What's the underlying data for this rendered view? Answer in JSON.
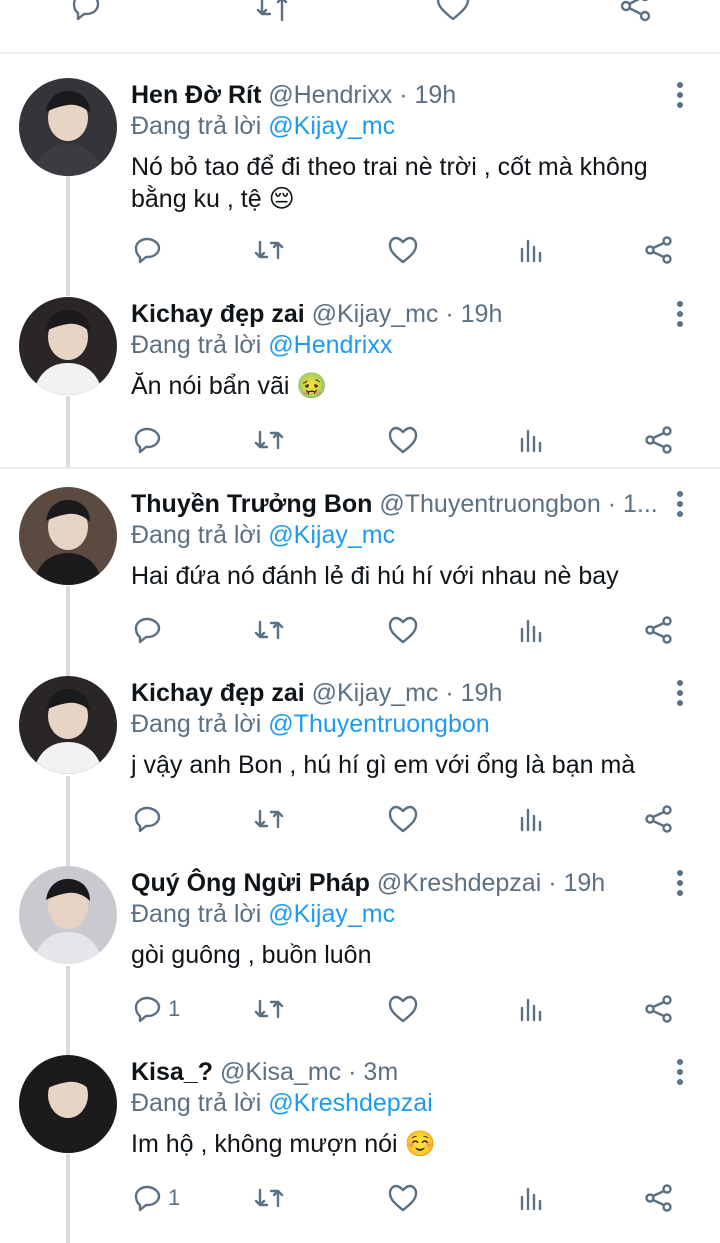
{
  "tweets": [
    {
      "name": "Hen Đờ Rít",
      "handle": "@Hendrixx",
      "time": "· 19h",
      "reply_prefix": "Đang trả lời",
      "reply_to": "@Kijay_mc",
      "text": "Nó bỏ tao để đi theo trai nè trời , cốt mà không bằng ku , tệ 😔",
      "reply_count": "",
      "avatar_bg": "#35343a"
    },
    {
      "name": "Kichay đẹp zai",
      "handle": "@Kijay_mc",
      "time": "· 19h",
      "reply_prefix": "Đang trả lời",
      "reply_to": "@Hendrixx",
      "text": "Ăn nói bẩn vãi 🤢",
      "reply_count": "",
      "avatar_bg": "#2a2628"
    },
    {
      "name": "Thuyền Trưởng Bon",
      "handle": "@Thuyentruongbon",
      "time": "· 1...",
      "reply_prefix": "Đang trả lời",
      "reply_to": "@Kijay_mc",
      "text": "Hai đứa nó đánh lẻ đi hú hí với nhau nè bay",
      "reply_count": "",
      "avatar_bg": "#5b4a40"
    },
    {
      "name": "Kichay đẹp zai",
      "handle": "@Kijay_mc",
      "time": "· 19h",
      "reply_prefix": "Đang trả lời",
      "reply_to": "@Thuyentruongbon",
      "text": "j vậy anh Bon , hú hí gì em với ổng là bạn mà",
      "reply_count": "",
      "avatar_bg": "#2a2628"
    },
    {
      "name": "Quý Ông Ngừi Pháp",
      "handle": "@Kreshdepzai",
      "time": "· 19h",
      "reply_prefix": "Đang trả lời",
      "reply_to": "@Kijay_mc",
      "text": "gòi guông , buồn luôn",
      "reply_count": "1",
      "avatar_bg": "#c9c9cf"
    },
    {
      "name": "Kisa_?",
      "handle": "@Kisa_mc",
      "time": "· 3m",
      "reply_prefix": "Đang trả lời",
      "reply_to": "@Kreshdepzai",
      "text": "Im hộ , không mượn nói ☺️",
      "reply_count": "1",
      "avatar_bg": "#1c1a1a"
    }
  ],
  "icons": {
    "reply": "reply-icon",
    "retweet": "retweet-icon",
    "like": "like-icon",
    "views": "views-icon",
    "share": "share-icon",
    "more": "more-icon"
  },
  "colors": {
    "link": "#1d9bf0",
    "muted": "#5b7083",
    "text": "#0f1419",
    "divider": "#eaecee",
    "thread_line": "#d7dce0"
  }
}
